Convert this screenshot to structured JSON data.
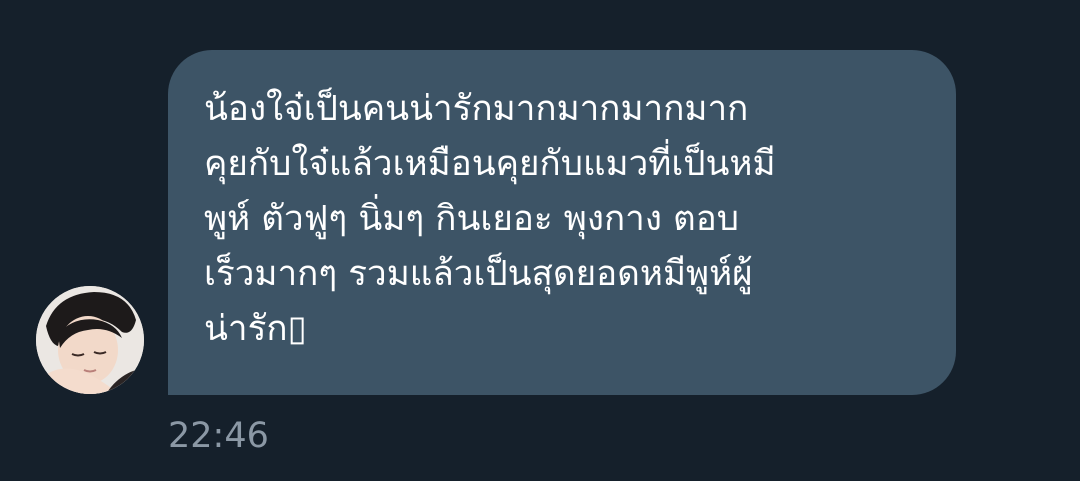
{
  "conversation": {
    "message": {
      "text": "น้องใจ๋เป็นคนน่ารักมากมากมากมาก\nคุยกับใจ๋แล้วเหมือนคุยกับแมวที่เป็นหมี\nพูห์ ตัวฟูๆ นิ่มๆ กินเยอะ พุงกาง  ตอบ\nเร็วมากๆ รวมแล้วเป็นสุดยอดหมีพูห์ผู้\nน่ารัก▯",
      "timestamp": "22:46"
    },
    "sender": {
      "avatar_icon": "profile-photo"
    }
  },
  "colors": {
    "background": "#15202b",
    "bubble": "#3d5466",
    "text": "#ffffff",
    "timestamp": "#8b98a5"
  }
}
